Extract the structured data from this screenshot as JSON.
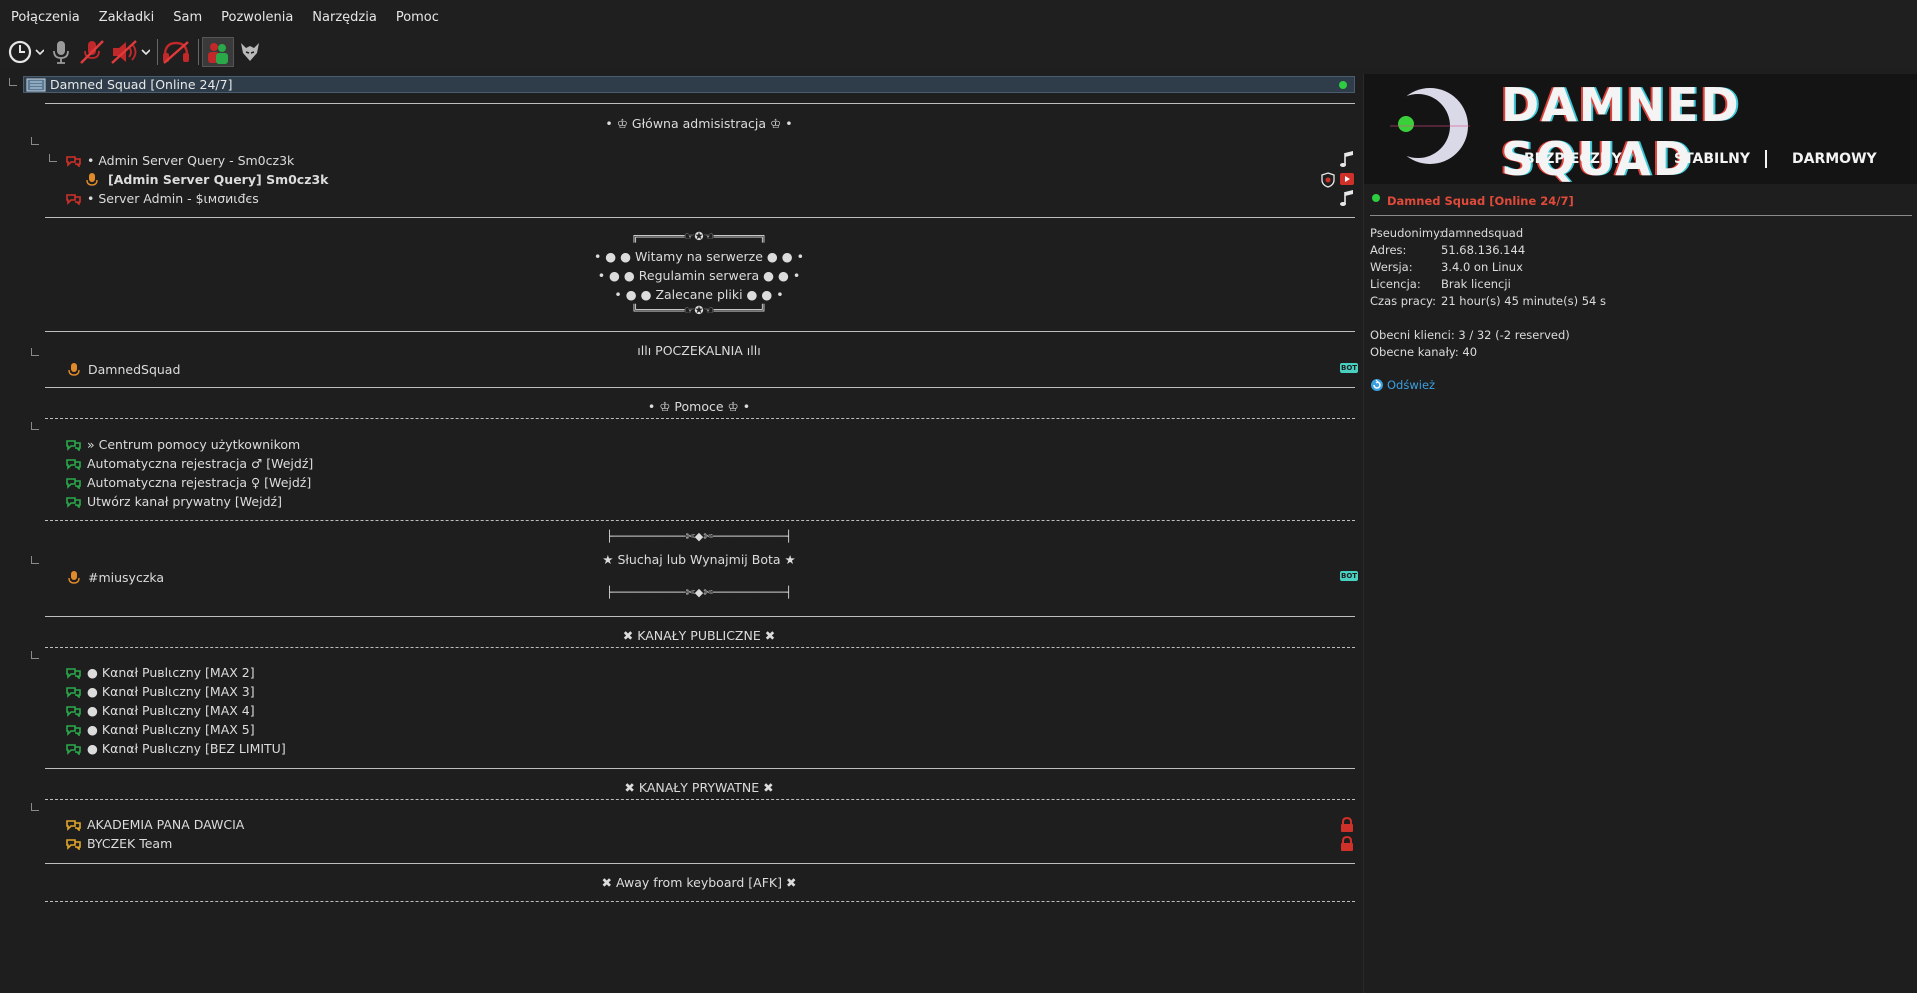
{
  "menu": [
    "Połączenia",
    "Zakładki",
    "Sam",
    "Pozwolenia",
    "Narzędzia",
    "Pomoc"
  ],
  "server": {
    "name": "Damned Squad [Online 24/7]"
  },
  "tree": {
    "admin_header": "• ♔ Główna admisistracja ♔ •",
    "admin_channel": "• Admin Server Query - Sm0cz3k",
    "admin_client": "[Admin Server Query] Sm0cz3k",
    "server_admin": "• Server Admin - $ιмσиιđєѕ",
    "welcome_top": "╔═══════☞✪☜═══════╗",
    "welcome_lines": [
      "• ● ● Witamy na serwerze ● ● •",
      "• ● ● Regulamin serwera ● ● •",
      "• ● ● Zalecane pliki ● ● •"
    ],
    "welcome_bottom": "╚═══════☞✪☜═══════╝",
    "waiting_header": "ıllı POCZEKALNIA ıllı",
    "waiting_client": "DamnedSquad",
    "help_header": "• ♔ Pomoce ♔ •",
    "help_channels": [
      "» Centrum pomocy użytkownikom",
      "Automatyczna rejestracja ♂ [Wejdź]",
      "Automatyczna rejestracja ♀ [Wejdź]",
      "Utwórz kanał prywatny [Wejdź]"
    ],
    "bot_top": "├───────────✄◆✄───────────┤",
    "bot_header": "★ Słuchaj lub Wynajmij Bota ★",
    "bot_client": "#miusyczka",
    "bot_bottom": "├───────────✄◆✄───────────┤",
    "public_header": "✖ KANAŁY PUBLICZNE ✖",
    "public_channels": [
      "● Kαnαł Puвlιcznу [MAX 2]",
      "● Kαnαł Puвlιcznу [MAX 3]",
      "● Kαnαł Puвlιcznу [MAX 4]",
      "● Kαnαł Puвlιcznу [MAX 5]",
      "● Kαnαł Puвlιcznу [BEZ LIMITU]"
    ],
    "private_header": "✖ KANAŁY PRYWATNE ✖",
    "private_channels": [
      "AKADEMIA PANA DAWCIA",
      "BYCZEK Team"
    ],
    "afk_header": "✖ Away from keyboard [AFK] ✖",
    "bot_badge": "BOT"
  },
  "info": {
    "banner_title": "DAMNED SQUAD",
    "banner_tags": [
      "BEZPIECZNY",
      "STABILNY",
      "DARMOWY"
    ],
    "server_name": "Damned Squad [Online 24/7]",
    "fields": [
      {
        "k": "Pseudonimy:",
        "v": "damnedsquad"
      },
      {
        "k": "Adres:",
        "v": "51.68.136.144"
      },
      {
        "k": "Wersja:",
        "v": "3.4.0 on Linux"
      },
      {
        "k": "Licencja:",
        "v": "Brak licencji"
      },
      {
        "k": "Czas pracy:",
        "v": "21 hour(s) 45 minute(s) 54 s"
      }
    ],
    "clients": "Obecni klienci:  3 / 32 (-2 reserved)",
    "channels": "Obecne kanały: 40",
    "refresh": "Odśwież"
  },
  "colors": {
    "accent_red": "#e04a3a",
    "link_blue": "#3aa0e0",
    "status_green": "#2ecc40"
  }
}
